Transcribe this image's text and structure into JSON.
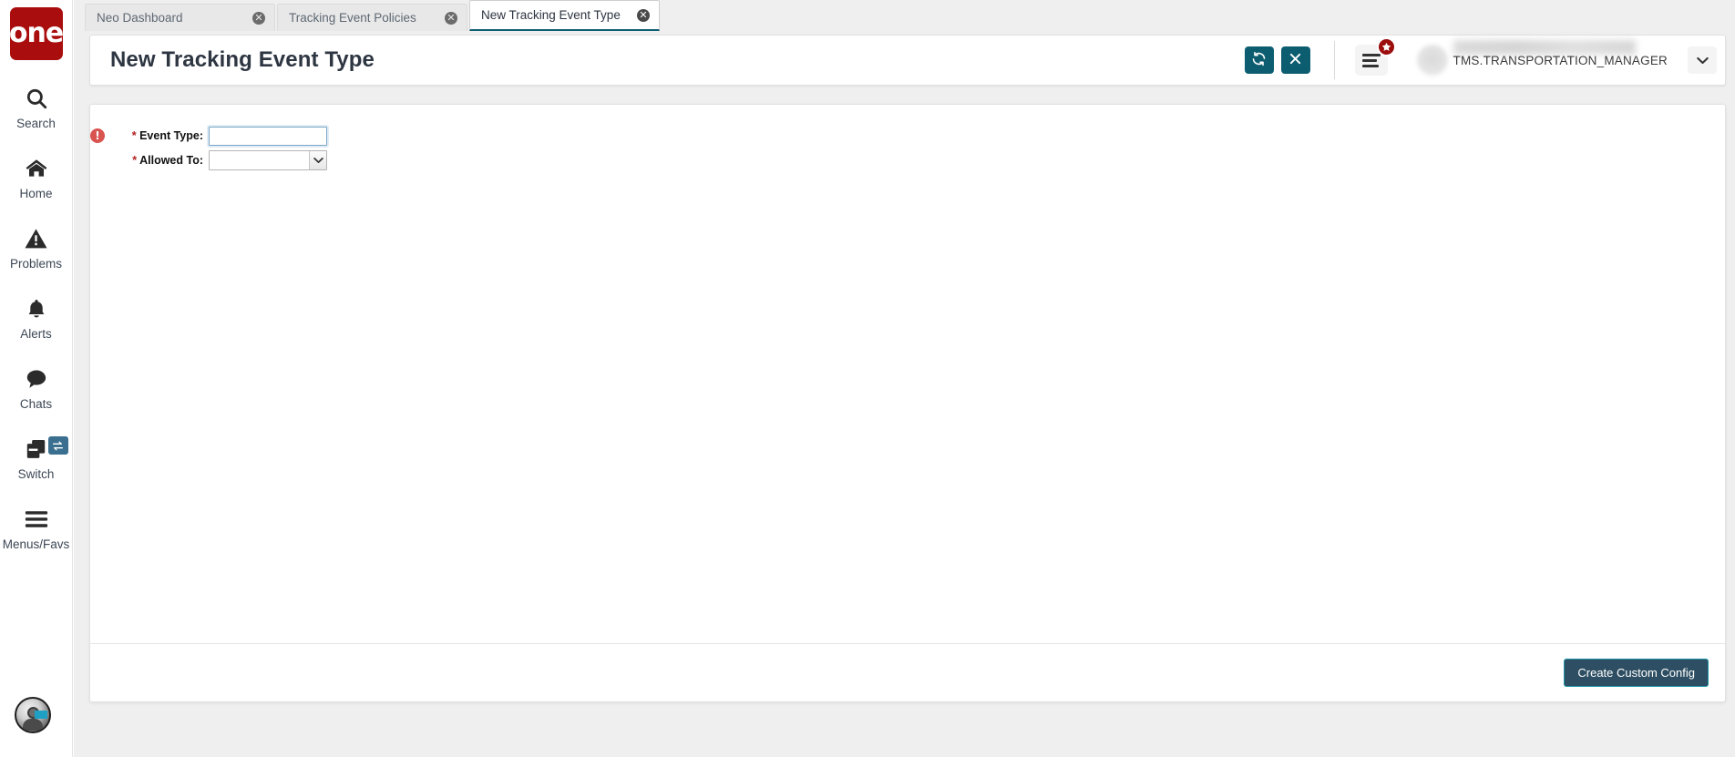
{
  "brand": {
    "logo_text": "one"
  },
  "sidebar": {
    "items": [
      {
        "label": "Search",
        "icon": "search-icon"
      },
      {
        "label": "Home",
        "icon": "home-icon"
      },
      {
        "label": "Problems",
        "icon": "warning-triangle-icon"
      },
      {
        "label": "Alerts",
        "icon": "bell-icon"
      },
      {
        "label": "Chats",
        "icon": "chat-bubble-icon"
      },
      {
        "label": "Switch",
        "icon": "windows-stack-icon",
        "badge_icon": "swap-arrows-icon"
      },
      {
        "label": "Menus/Favs",
        "icon": "hamburger-icon"
      }
    ],
    "avatar_name": "user-avatar"
  },
  "tabs": [
    {
      "label": "Neo Dashboard",
      "active": false,
      "close_icon": "close-circle-icon"
    },
    {
      "label": "Tracking Event Policies",
      "active": false,
      "close_icon": "close-circle-icon"
    },
    {
      "label": "New Tracking Event Type",
      "active": true,
      "close_icon": "close-circle-icon"
    }
  ],
  "header": {
    "title": "New Tracking Event Type",
    "refresh_icon": "refresh-icon",
    "close_icon": "close-x-icon",
    "menu_icon": "menu-lines-icon",
    "favorite_badge_icon": "star-icon",
    "user_name": "TMS.TRANSPORTATION_MANAGER",
    "user_caret_icon": "chevron-down-icon"
  },
  "form": {
    "fields": [
      {
        "name": "event-type",
        "label": "Event Type:",
        "required_star": "*",
        "required_icon": "required-error-icon",
        "show_required_icon": true,
        "type": "text",
        "value": "",
        "placeholder": ""
      },
      {
        "name": "allowed-to",
        "label": "Allowed To:",
        "required_star": "*",
        "required_icon": "required-error-icon",
        "show_required_icon": false,
        "type": "select",
        "value": "",
        "options": [
          ""
        ]
      }
    ]
  },
  "footer": {
    "create_custom_config_label": "Create Custom Config"
  },
  "colors": {
    "brand_red": "#a90d0d",
    "teal_button": "#0d5d70",
    "footer_button_bg": "#2e4f63",
    "footer_button_border": "#1c93a8",
    "required_red": "#d9534f",
    "active_tab_underline": "#0d5d70",
    "page_bg": "#efefef"
  }
}
